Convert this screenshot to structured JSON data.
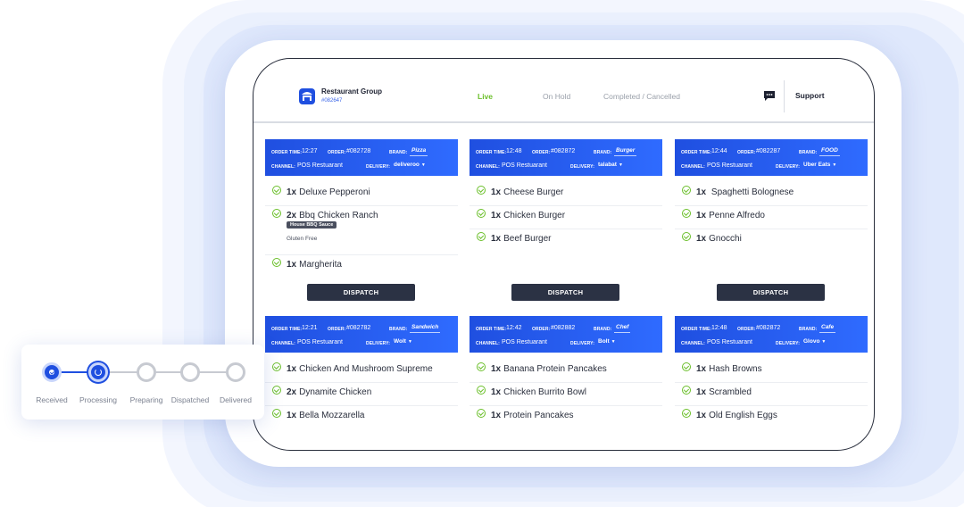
{
  "header": {
    "group_name": "Restaurant Group",
    "group_id": "#082647",
    "tabs": [
      {
        "label": "Live",
        "active": true
      },
      {
        "label": "On Hold",
        "active": false
      },
      {
        "label": "Completed / Cancelled",
        "active": false
      }
    ],
    "support_label": "Support"
  },
  "labels": {
    "order_time": "ORDER TIME:",
    "order": "ORDER:",
    "brand": "BRAND:",
    "channel": "CHANNEL:",
    "delivery": "DELIVERY:",
    "dispatch": "DISPATCH"
  },
  "orders": [
    {
      "time": "12:27",
      "number": "#082728",
      "brand": "Pizza",
      "channel": "POS Restuarant",
      "delivery": "deliveroo",
      "items": [
        {
          "qty": "1x",
          "name": "Deluxe Pepperoni"
        },
        {
          "qty": "2x",
          "name": "Bbq Chicken Ranch",
          "modifier": "House BBQ Sauce",
          "note": "Gluten Free"
        },
        {
          "qty": "1x",
          "name": "Margherita"
        }
      ]
    },
    {
      "time": "12:48",
      "number": "#082872",
      "brand": "Burger",
      "channel": "POS Restuarant",
      "delivery": "talabat",
      "items": [
        {
          "qty": "1x",
          "name": "Cheese Burger"
        },
        {
          "qty": "1x",
          "name": "Chicken Burger"
        },
        {
          "qty": "1x",
          "name": "Beef Burger"
        }
      ]
    },
    {
      "time": "12:44",
      "number": "#082287",
      "brand": "FOOD",
      "channel": "POS Restuarant",
      "delivery": "Uber Eats",
      "items": [
        {
          "qty": "1x",
          "name": " Spaghetti Bolognese"
        },
        {
          "qty": "1x",
          "name": "Penne Alfredo"
        },
        {
          "qty": "1x",
          "name": "Gnocchi"
        }
      ]
    },
    {
      "time": "12:21",
      "number": "#082782",
      "brand": "Sandwich",
      "channel": "POS Restuarant",
      "delivery": "Wolt",
      "items": [
        {
          "qty": "1x",
          "name": "Chicken And Mushroom Supreme"
        },
        {
          "qty": "2x",
          "name": "Dynamite Chicken"
        },
        {
          "qty": "1x",
          "name": "Bella Mozzarella"
        }
      ]
    },
    {
      "time": "12:42",
      "number": "#082882",
      "brand": "Chef",
      "channel": "POS Restuarant",
      "delivery": "Bolt",
      "items": [
        {
          "qty": "1x",
          "name": "Banana Protein Pancakes"
        },
        {
          "qty": "1x",
          "name": "Chicken Burrito Bowl"
        },
        {
          "qty": "1x",
          "name": "Protein Pancakes"
        }
      ]
    },
    {
      "time": "12:48",
      "number": "#082872",
      "brand": "Cafe",
      "channel": "POS Restuarant",
      "delivery": "Glovo",
      "items": [
        {
          "qty": "1x",
          "name": "Hash Browns"
        },
        {
          "qty": "1x",
          "name": "Scrambled"
        },
        {
          "qty": "1x",
          "name": "Old English Eggs"
        }
      ]
    }
  ],
  "tracker": {
    "steps": [
      {
        "label": "Received",
        "state": "done"
      },
      {
        "label": "Processing",
        "state": "processing"
      },
      {
        "label": "Preparing",
        "state": "pending"
      },
      {
        "label": "Dispatched",
        "state": "pending"
      },
      {
        "label": "Delivered",
        "state": "pending"
      }
    ]
  },
  "colors": {
    "accent": "#1f4fe0",
    "live_tab": "#6bbf2a",
    "dispatch_button": "#2b3244"
  }
}
